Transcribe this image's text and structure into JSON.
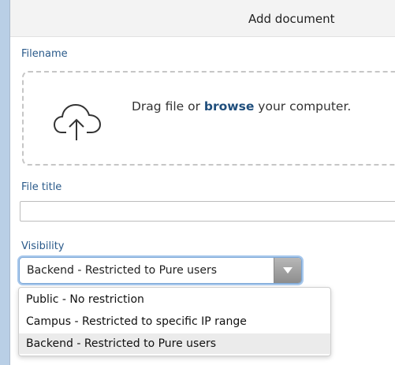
{
  "dialog": {
    "title": "Add document"
  },
  "filename": {
    "label": "Filename",
    "drop_prefix": "Drag file or",
    "browse_label": "browse",
    "drop_suffix": "your computer.",
    "icon": "cloud-upload-icon"
  },
  "file_title": {
    "label": "File title",
    "value": ""
  },
  "visibility": {
    "label": "Visibility",
    "selected": "Backend - Restricted to Pure users",
    "options": [
      "Public - No restriction",
      "Campus - Restricted to specific IP range",
      "Backend - Restricted to Pure users"
    ]
  },
  "colors": {
    "accent": "#1f4e7c",
    "label": "#2a5a8a",
    "focus": "#7aa6d6"
  }
}
